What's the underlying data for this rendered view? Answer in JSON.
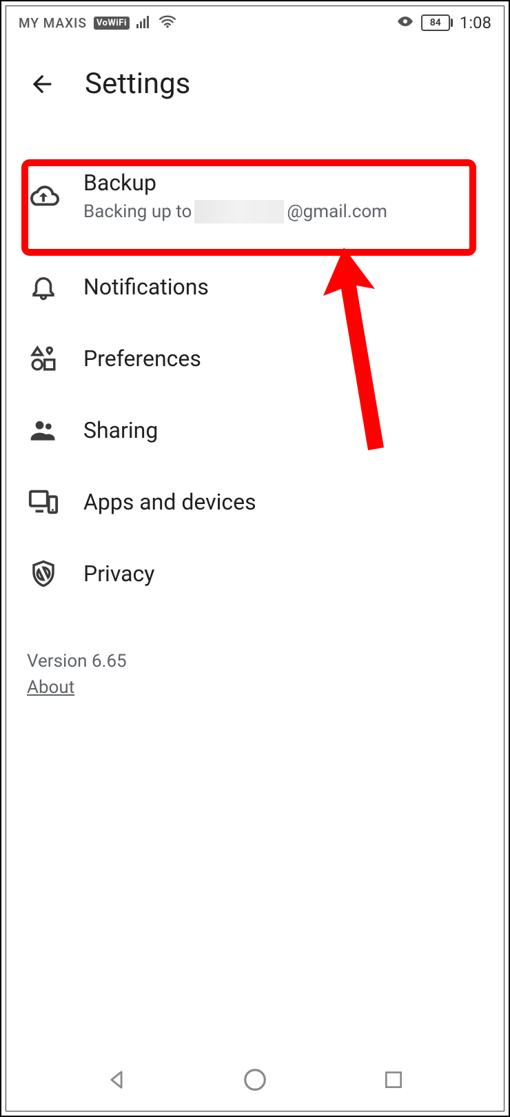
{
  "statusbar": {
    "carrier": "MY MAXIS",
    "vowifi": "VoWiFi",
    "battery": "84",
    "time": "1:08"
  },
  "header": {
    "title": "Settings"
  },
  "items": {
    "backup": {
      "label": "Backup",
      "sub_prefix": "Backing up to ",
      "sub_suffix": "@gmail.com"
    },
    "notifications": {
      "label": "Notifications"
    },
    "preferences": {
      "label": "Preferences"
    },
    "sharing": {
      "label": "Sharing"
    },
    "apps": {
      "label": "Apps and devices"
    },
    "privacy": {
      "label": "Privacy"
    }
  },
  "footer": {
    "version": "Version 6.65",
    "about": "About"
  }
}
